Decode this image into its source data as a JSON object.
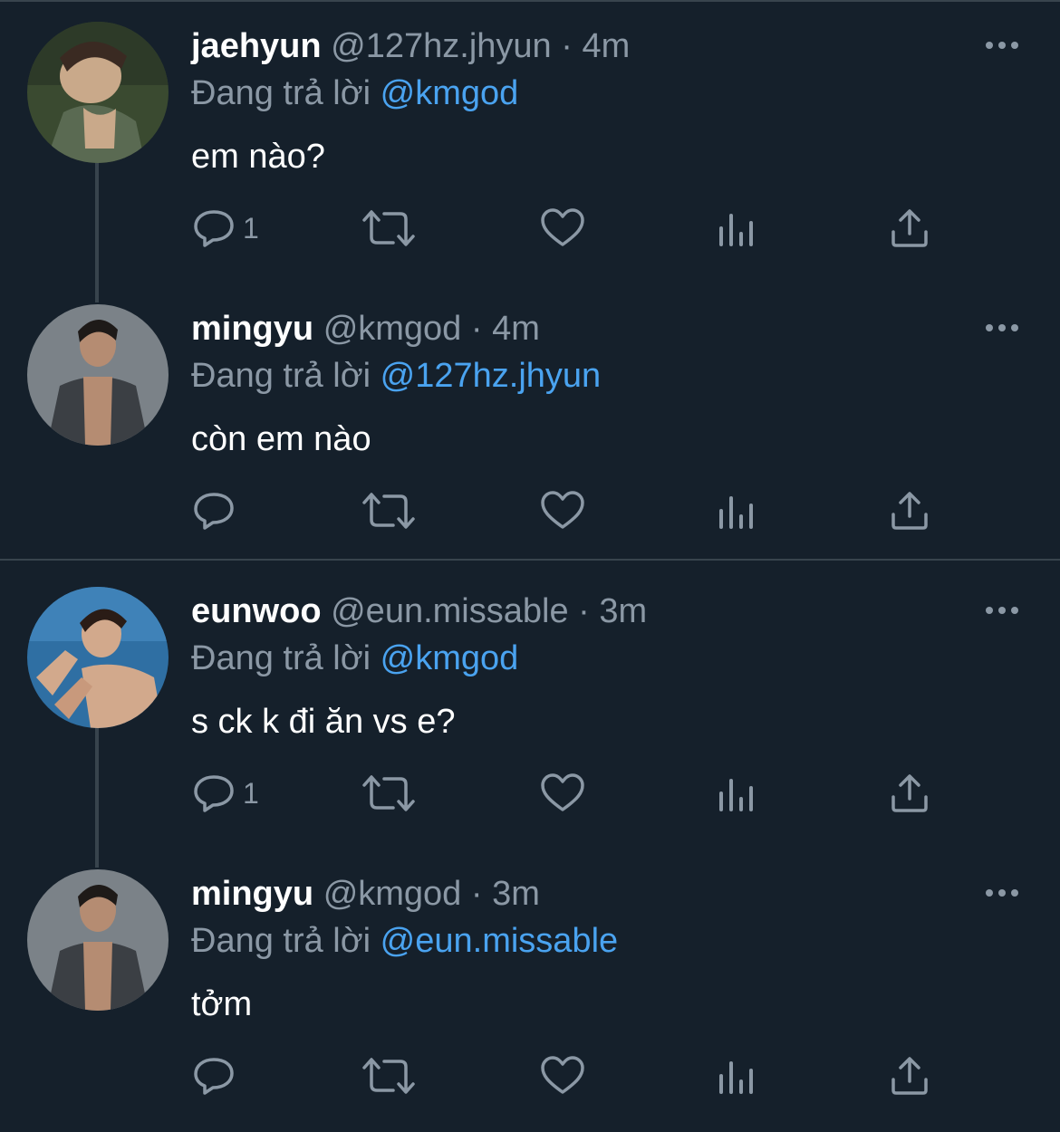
{
  "colors": {
    "background": "#15202b",
    "border": "#38444d",
    "secondary_text": "#8b98a5",
    "mention": "#4aa3f0"
  },
  "separator": "·",
  "tweets": [
    {
      "name": "jaehyun",
      "handle": "@127hz.jhyun",
      "time": "4m",
      "replying_prefix": "Đang trả lời",
      "replying_to": "@kmgod",
      "text": "em nào?",
      "reply_count": "1",
      "avatar": "jaehyun-avatar"
    },
    {
      "name": "mingyu",
      "handle": "@kmgod",
      "time": "4m",
      "replying_prefix": "Đang trả lời",
      "replying_to": "@127hz.jhyun",
      "text": "còn em nào",
      "reply_count": "",
      "avatar": "mingyu-avatar"
    },
    {
      "name": "eunwoo",
      "handle": "@eun.missable",
      "time": "3m",
      "replying_prefix": "Đang trả lời",
      "replying_to": "@kmgod",
      "text": "s ck k đi ăn vs e?",
      "reply_count": "1",
      "avatar": "eunwoo-avatar"
    },
    {
      "name": "mingyu",
      "handle": "@kmgod",
      "time": "3m",
      "replying_prefix": "Đang trả lời",
      "replying_to": "@eun.missable",
      "text": "tởm",
      "reply_count": "",
      "avatar": "mingyu-avatar"
    }
  ],
  "icons": [
    "reply-icon",
    "retweet-icon",
    "like-icon",
    "analytics-icon",
    "share-icon",
    "more-icon"
  ]
}
